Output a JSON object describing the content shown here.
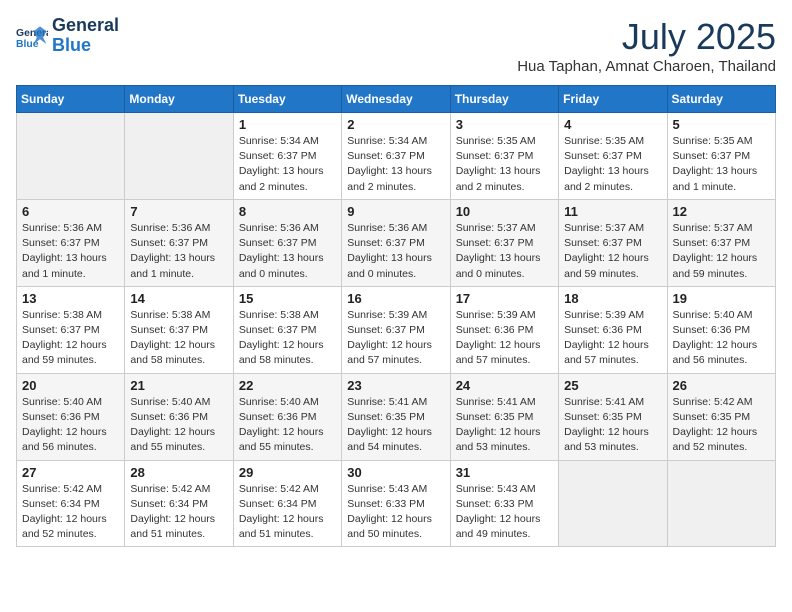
{
  "header": {
    "logo_line1": "General",
    "logo_line2": "Blue",
    "month": "July 2025",
    "location": "Hua Taphan, Amnat Charoen, Thailand"
  },
  "weekdays": [
    "Sunday",
    "Monday",
    "Tuesday",
    "Wednesday",
    "Thursday",
    "Friday",
    "Saturday"
  ],
  "weeks": [
    [
      {
        "day": "",
        "detail": ""
      },
      {
        "day": "",
        "detail": ""
      },
      {
        "day": "1",
        "detail": "Sunrise: 5:34 AM\nSunset: 6:37 PM\nDaylight: 13 hours\nand 2 minutes."
      },
      {
        "day": "2",
        "detail": "Sunrise: 5:34 AM\nSunset: 6:37 PM\nDaylight: 13 hours\nand 2 minutes."
      },
      {
        "day": "3",
        "detail": "Sunrise: 5:35 AM\nSunset: 6:37 PM\nDaylight: 13 hours\nand 2 minutes."
      },
      {
        "day": "4",
        "detail": "Sunrise: 5:35 AM\nSunset: 6:37 PM\nDaylight: 13 hours\nand 2 minutes."
      },
      {
        "day": "5",
        "detail": "Sunrise: 5:35 AM\nSunset: 6:37 PM\nDaylight: 13 hours\nand 1 minute."
      }
    ],
    [
      {
        "day": "6",
        "detail": "Sunrise: 5:36 AM\nSunset: 6:37 PM\nDaylight: 13 hours\nand 1 minute."
      },
      {
        "day": "7",
        "detail": "Sunrise: 5:36 AM\nSunset: 6:37 PM\nDaylight: 13 hours\nand 1 minute."
      },
      {
        "day": "8",
        "detail": "Sunrise: 5:36 AM\nSunset: 6:37 PM\nDaylight: 13 hours\nand 0 minutes."
      },
      {
        "day": "9",
        "detail": "Sunrise: 5:36 AM\nSunset: 6:37 PM\nDaylight: 13 hours\nand 0 minutes."
      },
      {
        "day": "10",
        "detail": "Sunrise: 5:37 AM\nSunset: 6:37 PM\nDaylight: 13 hours\nand 0 minutes."
      },
      {
        "day": "11",
        "detail": "Sunrise: 5:37 AM\nSunset: 6:37 PM\nDaylight: 12 hours\nand 59 minutes."
      },
      {
        "day": "12",
        "detail": "Sunrise: 5:37 AM\nSunset: 6:37 PM\nDaylight: 12 hours\nand 59 minutes."
      }
    ],
    [
      {
        "day": "13",
        "detail": "Sunrise: 5:38 AM\nSunset: 6:37 PM\nDaylight: 12 hours\nand 59 minutes."
      },
      {
        "day": "14",
        "detail": "Sunrise: 5:38 AM\nSunset: 6:37 PM\nDaylight: 12 hours\nand 58 minutes."
      },
      {
        "day": "15",
        "detail": "Sunrise: 5:38 AM\nSunset: 6:37 PM\nDaylight: 12 hours\nand 58 minutes."
      },
      {
        "day": "16",
        "detail": "Sunrise: 5:39 AM\nSunset: 6:37 PM\nDaylight: 12 hours\nand 57 minutes."
      },
      {
        "day": "17",
        "detail": "Sunrise: 5:39 AM\nSunset: 6:36 PM\nDaylight: 12 hours\nand 57 minutes."
      },
      {
        "day": "18",
        "detail": "Sunrise: 5:39 AM\nSunset: 6:36 PM\nDaylight: 12 hours\nand 57 minutes."
      },
      {
        "day": "19",
        "detail": "Sunrise: 5:40 AM\nSunset: 6:36 PM\nDaylight: 12 hours\nand 56 minutes."
      }
    ],
    [
      {
        "day": "20",
        "detail": "Sunrise: 5:40 AM\nSunset: 6:36 PM\nDaylight: 12 hours\nand 56 minutes."
      },
      {
        "day": "21",
        "detail": "Sunrise: 5:40 AM\nSunset: 6:36 PM\nDaylight: 12 hours\nand 55 minutes."
      },
      {
        "day": "22",
        "detail": "Sunrise: 5:40 AM\nSunset: 6:36 PM\nDaylight: 12 hours\nand 55 minutes."
      },
      {
        "day": "23",
        "detail": "Sunrise: 5:41 AM\nSunset: 6:35 PM\nDaylight: 12 hours\nand 54 minutes."
      },
      {
        "day": "24",
        "detail": "Sunrise: 5:41 AM\nSunset: 6:35 PM\nDaylight: 12 hours\nand 53 minutes."
      },
      {
        "day": "25",
        "detail": "Sunrise: 5:41 AM\nSunset: 6:35 PM\nDaylight: 12 hours\nand 53 minutes."
      },
      {
        "day": "26",
        "detail": "Sunrise: 5:42 AM\nSunset: 6:35 PM\nDaylight: 12 hours\nand 52 minutes."
      }
    ],
    [
      {
        "day": "27",
        "detail": "Sunrise: 5:42 AM\nSunset: 6:34 PM\nDaylight: 12 hours\nand 52 minutes."
      },
      {
        "day": "28",
        "detail": "Sunrise: 5:42 AM\nSunset: 6:34 PM\nDaylight: 12 hours\nand 51 minutes."
      },
      {
        "day": "29",
        "detail": "Sunrise: 5:42 AM\nSunset: 6:34 PM\nDaylight: 12 hours\nand 51 minutes."
      },
      {
        "day": "30",
        "detail": "Sunrise: 5:43 AM\nSunset: 6:33 PM\nDaylight: 12 hours\nand 50 minutes."
      },
      {
        "day": "31",
        "detail": "Sunrise: 5:43 AM\nSunset: 6:33 PM\nDaylight: 12 hours\nand 49 minutes."
      },
      {
        "day": "",
        "detail": ""
      },
      {
        "day": "",
        "detail": ""
      }
    ]
  ]
}
